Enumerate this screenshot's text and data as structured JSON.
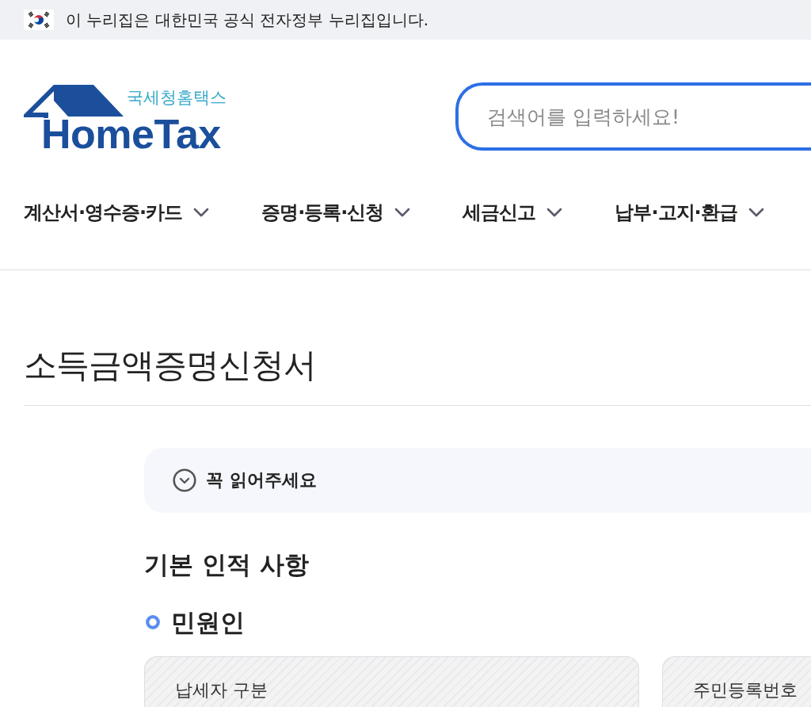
{
  "gov_banner": {
    "text": "이 누리집은 대한민국 공식 전자정부 누리집입니다."
  },
  "header": {
    "logo": {
      "subtitle": "국세청홈택스",
      "wordmark": "HomeTax"
    },
    "search": {
      "placeholder": "검색어를 입력하세요!"
    }
  },
  "nav": {
    "items": [
      {
        "label": "계산서·영수증·카드",
        "expanded": false
      },
      {
        "label": "증명·등록·신청",
        "expanded": false
      },
      {
        "label": "세금신고",
        "expanded": false
      },
      {
        "label": "납부·고지·환급",
        "expanded": false
      }
    ]
  },
  "page": {
    "title": "소득금액증명신청서"
  },
  "notice": {
    "label": "꼭 읽어주세요",
    "expanded": false
  },
  "section": {
    "title": "기본 인적 사항",
    "subsection": {
      "title": "민원인"
    },
    "fields": [
      {
        "label": "납세자 구분",
        "disabled": true
      },
      {
        "label": "주민등록번호",
        "disabled": true
      }
    ]
  }
}
